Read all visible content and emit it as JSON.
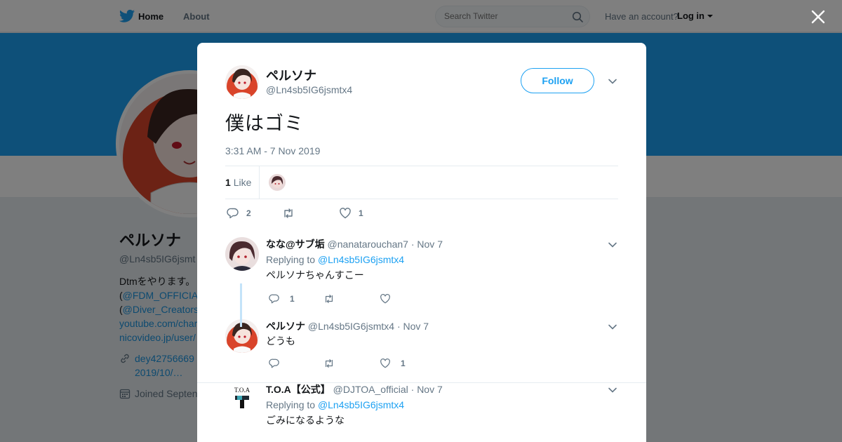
{
  "nav": {
    "home_label": "Home",
    "about_label": "About",
    "search_placeholder": "Search Twitter",
    "have_account": "Have an account?",
    "login_label": "Log in"
  },
  "profile": {
    "name": "ペルソナ",
    "handle": "@Ln4sb5IG6jsmt",
    "bio_line1": "Dtmをやります。",
    "bio_line2_prefix": "(",
    "bio_line2_link": "@FDM_OFFICIA",
    "bio_line3_prefix": "(",
    "bio_line3_link": "@Diver_Creators",
    "bio_line4": "youtube.com/char",
    "bio_line5": "nicovideo.jp/user/",
    "link_line1": "dey42756669",
    "link_line2": "2019/10/…",
    "joined": "Joined Septen"
  },
  "tweet": {
    "user_name": "ペルソナ",
    "user_handle": "@Ln4sb5IG6jsmtx4",
    "follow_label": "Follow",
    "text": "僕はゴミ",
    "timestamp": "3:31 AM - 7 Nov 2019",
    "likes_count": "1",
    "likes_label": "Like",
    "reply_count": "2",
    "retweet_count": "",
    "like_count": "1"
  },
  "replies": [
    {
      "name": "なな@サブ垢",
      "handle": "@nanatarouchan7",
      "date": "· Nov 7",
      "replying_prefix": "Replying to",
      "replying_to": "@Ln4sb5IG6jsmtx4",
      "text": "ペルソナちゃんすこー",
      "reply_count": "1",
      "retweet_count": "",
      "like_count": ""
    },
    {
      "name": "ペルソナ",
      "handle": "@Ln4sb5IG6jsmtx4",
      "date": "· Nov 7",
      "text": "どうも",
      "reply_count": "",
      "retweet_count": "",
      "like_count": "1"
    },
    {
      "name": "T.O.A【公式】",
      "handle": "@DJTOA_official",
      "date": "· Nov 7",
      "replying_prefix": "Replying to",
      "replying_to": "@Ln4sb5IG6jsmtx4",
      "text": "ごみになるような",
      "avatar_text": "T.O.A"
    }
  ],
  "colors": {
    "accent": "#1da1f2",
    "banner": "#1da1f2",
    "avatar_red": "#d9442a"
  }
}
